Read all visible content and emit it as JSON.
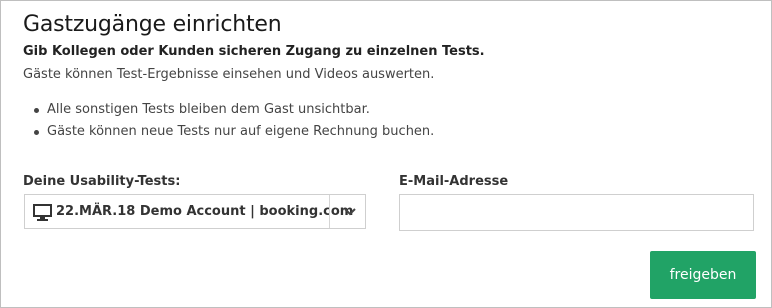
{
  "dialog": {
    "title": "Gastzugänge einrichten",
    "lead": "Gib Kollegen oder Kunden sicheren Zugang zu einzelnen Tests.",
    "subtext": "Gäste können Test-Ergebnisse einsehen und Videos auswerten.",
    "bullets": [
      "Alle sonstigen Tests bleiben dem Gast unsichtbar.",
      "Gäste können neue Tests nur auf eigene Rechnung buchen."
    ]
  },
  "form": {
    "tests_label": "Deine Usability-Tests:",
    "selected_test": "22.MÄR.18 Demo Account | booking.com",
    "selected_icon": "monitor-icon",
    "email_label": "E-Mail-Adresse",
    "email_value": "",
    "email_placeholder": ""
  },
  "actions": {
    "submit_label": "freigeben",
    "submit_color": "#21a366"
  }
}
